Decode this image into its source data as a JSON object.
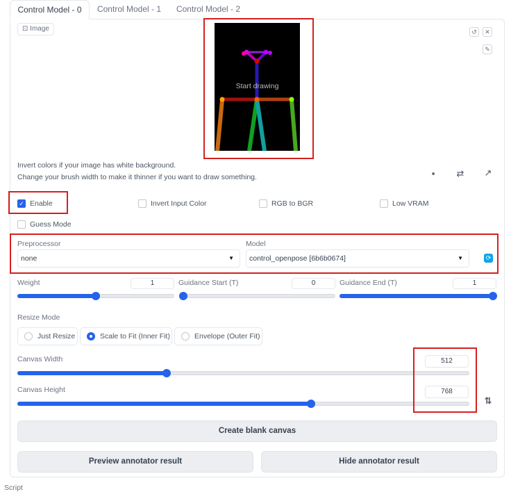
{
  "tabs": [
    {
      "label": "Control Model - 0",
      "active": true
    },
    {
      "label": "Control Model - 1",
      "active": false
    },
    {
      "label": "Control Model - 2",
      "active": false
    }
  ],
  "image_label": "Image",
  "canvas": {
    "placeholder": "Start drawing"
  },
  "help": {
    "line1": "Invert colors if your image has white background.",
    "line2": "Change your brush width to make it thinner if you want to draw something."
  },
  "checkboxes": {
    "enable": {
      "label": "Enable",
      "checked": true
    },
    "invert": {
      "label": "Invert Input Color",
      "checked": false
    },
    "rgb2bgr": {
      "label": "RGB to BGR",
      "checked": false
    },
    "lowvram": {
      "label": "Low VRAM",
      "checked": false
    },
    "guess": {
      "label": "Guess Mode",
      "checked": false
    }
  },
  "preprocessor": {
    "label": "Preprocessor",
    "value": "none"
  },
  "model": {
    "label": "Model",
    "value": "control_openpose [6b6b0674]"
  },
  "weight": {
    "label": "Weight",
    "value": "1",
    "fraction": 0.5
  },
  "guidance_start": {
    "label": "Guidance Start (T)",
    "value": "0",
    "fraction": 0.0
  },
  "guidance_end": {
    "label": "Guidance End (T)",
    "value": "1",
    "fraction": 1.0
  },
  "resize_mode": {
    "label": "Resize Mode",
    "options": [
      "Just Resize",
      "Scale to Fit (Inner Fit)",
      "Envelope (Outer Fit)"
    ],
    "selected": "Scale to Fit (Inner Fit)"
  },
  "canvas_width": {
    "label": "Canvas Width",
    "value": "512",
    "fraction": 0.33
  },
  "canvas_height": {
    "label": "Canvas Height",
    "value": "768",
    "fraction": 0.65
  },
  "buttons": {
    "create_blank": "Create blank canvas",
    "preview": "Preview annotator result",
    "hide": "Hide annotator result"
  },
  "footer": "Script",
  "colors": {
    "accent": "#2563eb",
    "highlight": "#d42020",
    "refresh": "#0ea5e9"
  }
}
